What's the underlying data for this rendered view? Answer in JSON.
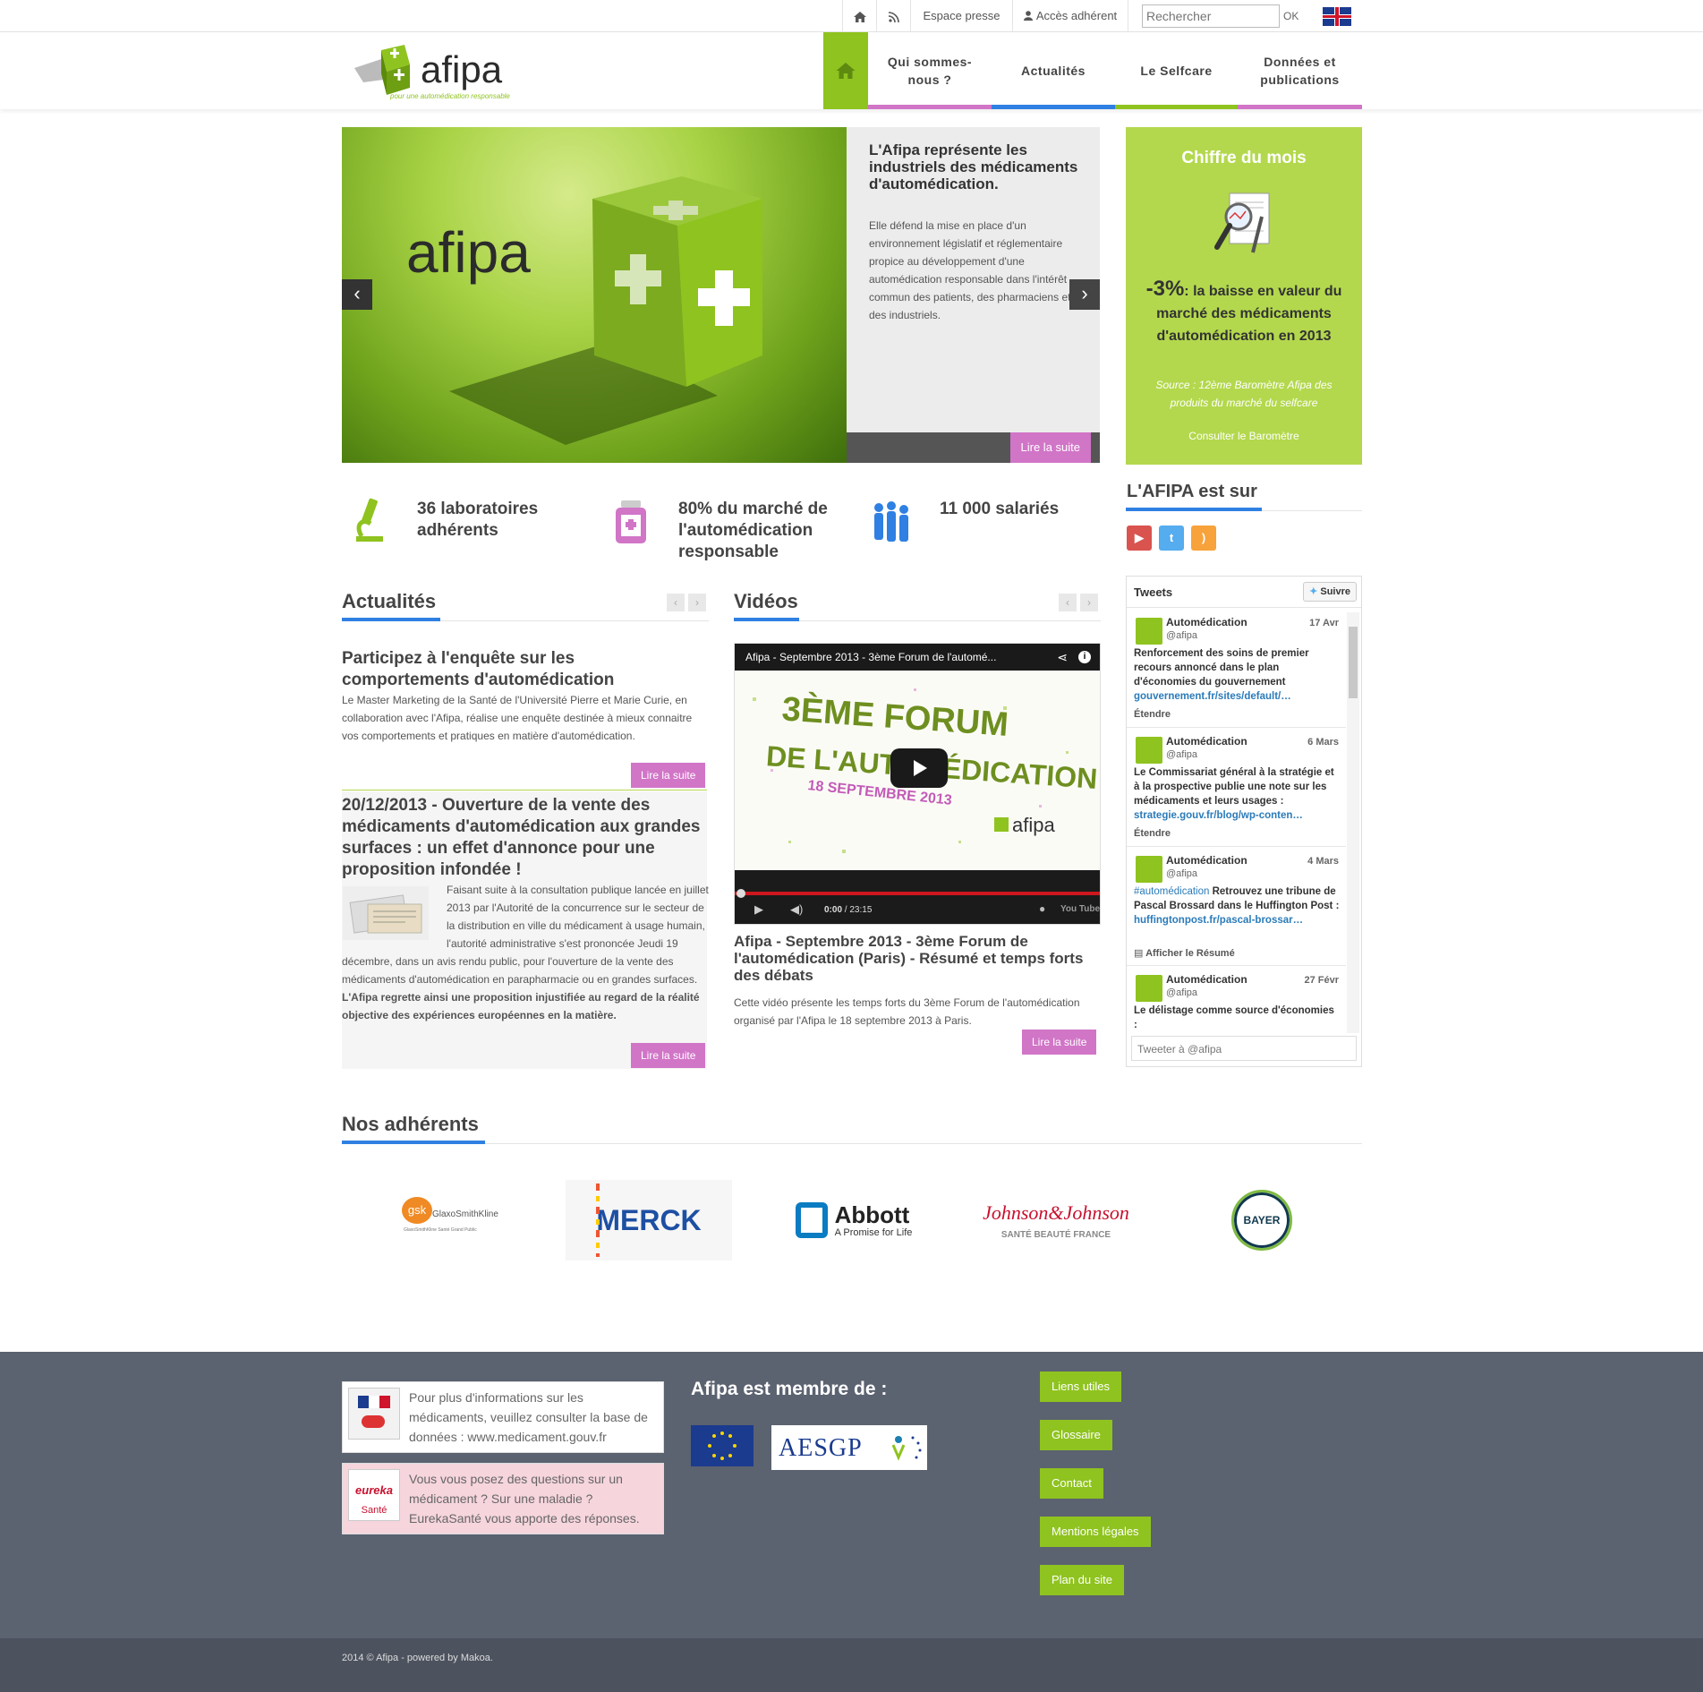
{
  "topbar": {
    "espace_presse": "Espace presse",
    "acces_adherent": "Accès adhérent",
    "search_placeholder": "Rechercher",
    "ok": "OK"
  },
  "brand": {
    "name": "afipa",
    "tagline": "pour une automédication responsable",
    "colors": {
      "green": "#8fc31f",
      "pink": "#d175c7",
      "blue": "#2f80e2",
      "chiffre_bg": "#b3d84d",
      "footer": "#5b6270"
    }
  },
  "nav": [
    {
      "label": "Qui sommes-nous ?",
      "color": "#d175c7"
    },
    {
      "label": "Actualités",
      "color": "#2f80e2"
    },
    {
      "label": "Le Selfcare",
      "color": "#8fc31f"
    },
    {
      "label": "Données et publications",
      "color": "#d175c7"
    }
  ],
  "hero": {
    "image_text": "afipa",
    "title": "L'Afipa représente les industriels des médicaments d'automédication.",
    "description": "Elle défend la mise en place d'un environnement législatif et réglementaire propice au développement d'une automédication responsable dans l'intérêt commun des patients, des pharmaciens et des industriels.",
    "more": "Lire la suite"
  },
  "chiffre": {
    "title": "Chiffre du mois",
    "value": "-3%",
    "text": ": la baisse en valeur du marché des médicaments d'automédication en 2013",
    "source": "Source : 12ème Baromètre Afipa des produits du marché du selfcare",
    "link": "Consulter le Baromètre"
  },
  "stats": [
    {
      "text": "36 laboratoires adhérents",
      "icon": "microscope-icon"
    },
    {
      "text": "80% du marché de l'automédication responsable",
      "icon": "pill-bottle-icon"
    },
    {
      "text": "11 000 salariés",
      "icon": "people-icon"
    }
  ],
  "social": {
    "title": "L'AFIPA est sur",
    "items": [
      {
        "name": "youtube-icon",
        "color": "#d9534f"
      },
      {
        "name": "twitter-icon",
        "color": "#55acee"
      },
      {
        "name": "rss-icon",
        "color": "#f7a23b"
      }
    ]
  },
  "actualites": {
    "title": "Actualités",
    "items": [
      {
        "title": "Participez à l'enquête sur les comportements d'automédication",
        "body": "Le Master Marketing de la Santé de l'Université Pierre et Marie Curie, en collaboration avec l'Afipa, réalise une enquête destinée à mieux connaitre vos comportements et pratiques en matière d'automédication.",
        "more": "Lire la suite"
      },
      {
        "title": "20/12/2013 - Ouverture de la vente des médicaments d'automédication aux grandes surfaces : un effet d'annonce pour une proposition infondée !",
        "body": "Faisant suite à la consultation publique lancée en juillet 2013 par l'Autorité de la concurrence sur le secteur de la distribution en ville du médicament à usage humain, l'autorité administrative s'est prononcée Jeudi 19 décembre, dans un avis rendu public, pour l'ouverture de la vente des médicaments d'automédication en parapharmacie ou en grandes surfaces.",
        "body_bold": "L'Afipa regrette ainsi une proposition injustifiée au regard de la réalité objective des expériences européennes en la matière.",
        "more": "Lire la suite"
      }
    ]
  },
  "videos": {
    "title": "Vidéos",
    "player_title": "Afipa - Septembre 2013 - 3ème Forum de l'automé...",
    "player_line1": "3ÈME FORUM",
    "player_line2": "DE L'AUTOMÉDICATION",
    "player_line3": "18 SEPTEMBRE 2013",
    "player_time": "0:00",
    "player_duration": "/ 23:15",
    "player_brand": "You Tube",
    "caption": "Afipa - Septembre 2013 - 3ème Forum de l'automédication (Paris) - Résumé et temps forts des débats",
    "description": "Cette vidéo présente les temps forts du 3ème Forum de l'automédication organisé par l'Afipa le 18 septembre 2013 à Paris.",
    "more": "Lire la suite"
  },
  "tweets": {
    "title": "Tweets",
    "follow": "Suivre",
    "compose": "Tweeter à @afipa",
    "items": [
      {
        "name": "Automédication",
        "handle": "@afipa",
        "date": "17 Avr",
        "text": "Renforcement des soins de premier recours annoncé dans le plan d'économies du gouvernement",
        "link": "gouvernement.fr/sites/default/…",
        "action": "Étendre"
      },
      {
        "name": "Automédication",
        "handle": "@afipa",
        "date": "6 Mars",
        "text": "Le Commissariat général à la stratégie et à la prospective publie une note sur les médicaments et leurs usages :",
        "link": "strategie.gouv.fr/blog/wp-conten…",
        "action": "Étendre"
      },
      {
        "name": "Automédication",
        "handle": "@afipa",
        "date": "4 Mars",
        "hashtag": "#automédication",
        "text": "Retrouvez une tribune de Pascal Brossard dans le Huffington Post :",
        "link": "huffingtonpost.fr/pascal-brossar…",
        "action": "Afficher le Résumé"
      },
      {
        "name": "Automédication",
        "handle": "@afipa",
        "date": "27 Févr",
        "text": "Le délistage comme source d'économies :",
        "link": "",
        "action": ""
      }
    ]
  },
  "adherents": {
    "title": "Nos adhérents",
    "logos": [
      {
        "name": "gsk",
        "label": "GlaxoSmithKline",
        "sub": "GlaxoSmithKline Santé Grand Public"
      },
      {
        "name": "merck",
        "label": "MERCK"
      },
      {
        "name": "abbott",
        "label": "Abbott",
        "sub": "A Promise for Life"
      },
      {
        "name": "johnson",
        "label": "Johnson&Johnson",
        "sub": "SANTÉ BEAUTÉ FRANCE"
      },
      {
        "name": "bayer",
        "label": "BAYER"
      }
    ]
  },
  "footer": {
    "box1": "Pour plus d'informations sur les médicaments, veuillez consulter la base de données : www.medicament.gouv.fr",
    "box2": "Vous vous posez des questions sur un médicament ? Sur une maladie ? EurekaSanté vous apporte des réponses.",
    "box2_logo_1": "eureka",
    "box2_logo_2": "Santé",
    "membre_title": "Afipa est membre de :",
    "aesgp": "AESGP",
    "links": [
      "Liens utiles",
      "Glossaire",
      "Contact",
      "Mentions légales",
      "Plan du site"
    ],
    "copyright": "2014 © Afipa - powered by Makoa."
  }
}
